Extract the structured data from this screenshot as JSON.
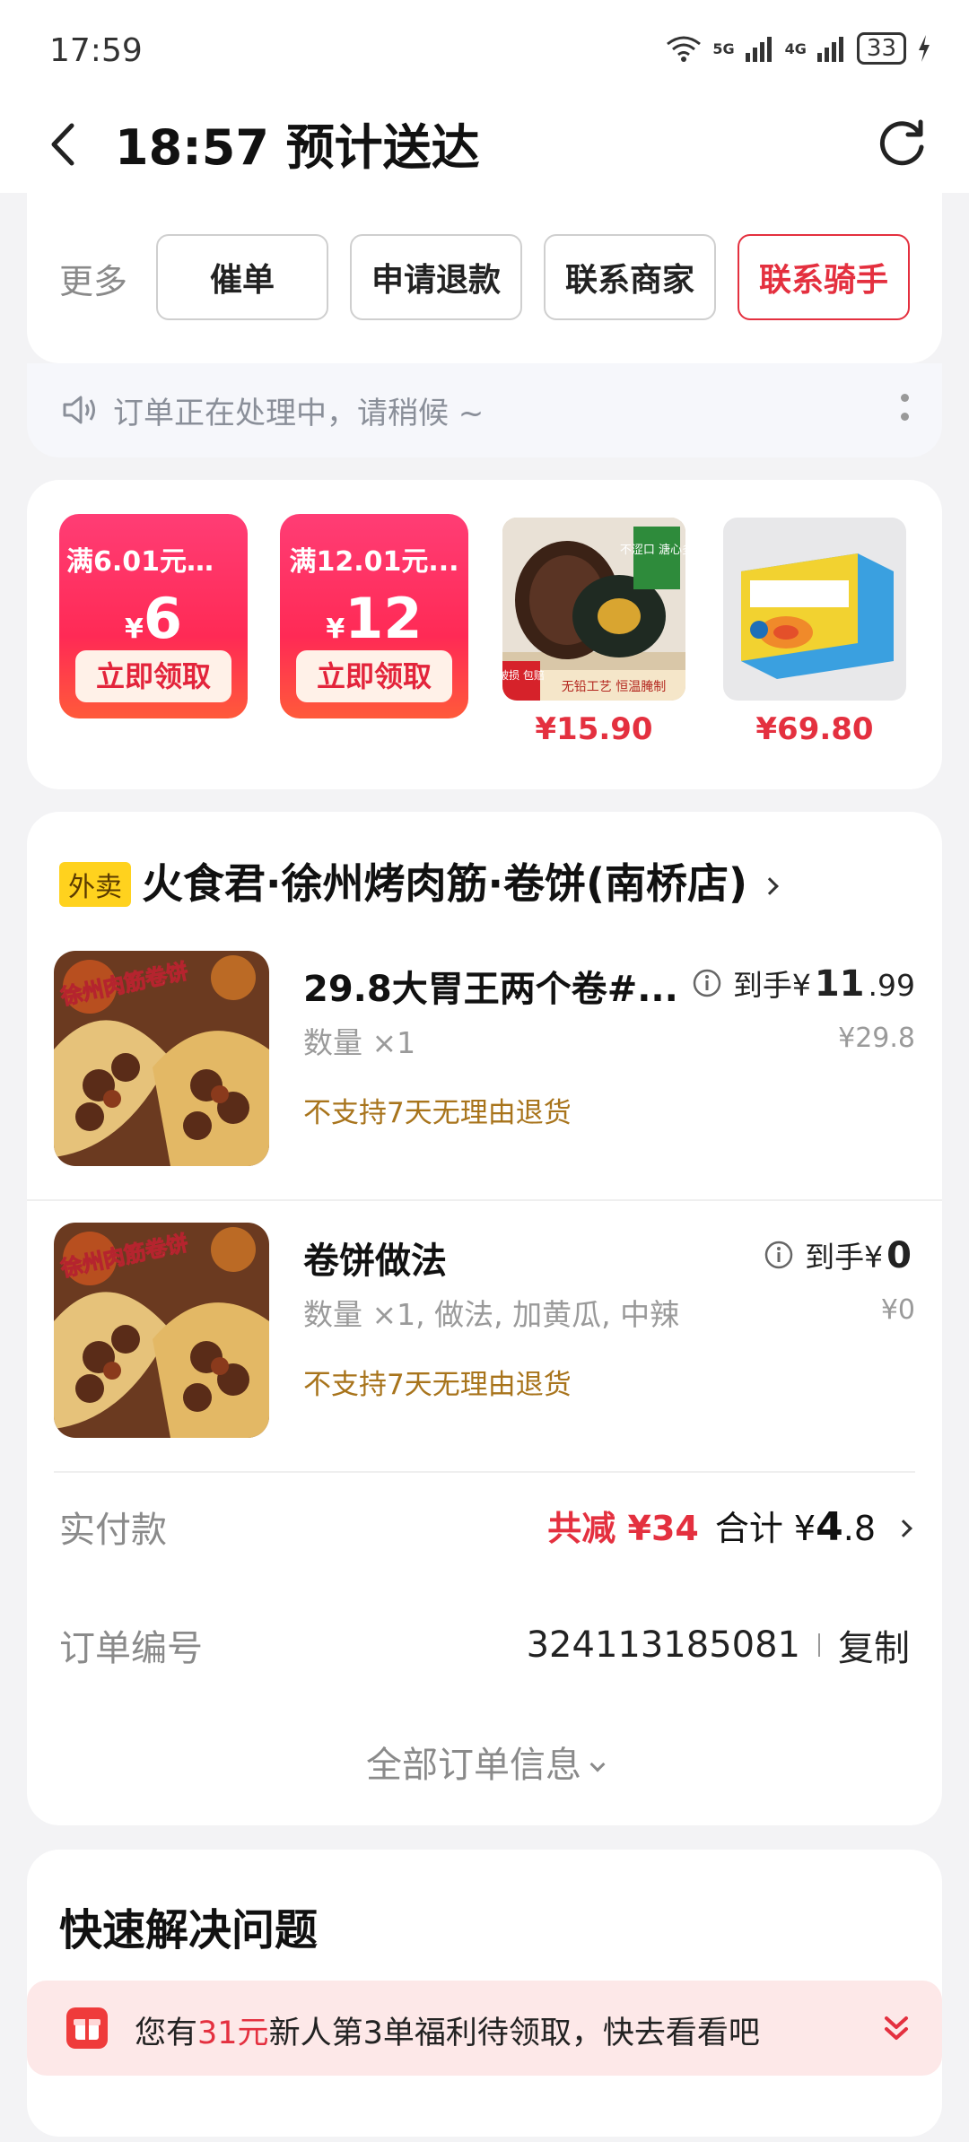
{
  "status": {
    "time": "17:59",
    "net1": "5G",
    "net2": "4G",
    "battery": "33"
  },
  "header": {
    "title": "18:57 预计送达"
  },
  "actions": {
    "more_label": "更多",
    "buttons": [
      "催单",
      "申请退款",
      "联系商家",
      "联系骑手"
    ]
  },
  "notice": {
    "text": "订单正在处理中，请稍候 ~"
  },
  "promos": {
    "coupons": [
      {
        "condition": "满6.01元可...",
        "currency": "¥",
        "amount": "6",
        "cta": "立即领取"
      },
      {
        "condition": "满12.01元...",
        "currency": "¥",
        "amount": "12",
        "cta": "立即领取"
      }
    ],
    "products": [
      {
        "price": "¥15.90",
        "label_top": "不涩口 溏心多",
        "label_bottom": "无铅工艺 恒温腌制",
        "badge": "破损 包赔"
      },
      {
        "price": "¥69.80"
      }
    ]
  },
  "order": {
    "tag": "外卖",
    "store": "火食君·徐州烤肉筋·卷饼(南桥店)",
    "items": [
      {
        "name": "29.8大胃王两个卷#...",
        "qty": "数量 ×1",
        "note": "不支持7天无理由退货",
        "price_prefix": "到手¥",
        "price_main": "11",
        "price_decimal": ".99",
        "original": "¥29.8",
        "img_text": "徐州肉筋卷饼"
      },
      {
        "name": "卷饼做法",
        "qty": "数量 ×1, 做法, 加黄瓜, 中辣",
        "note": "不支持7天无理由退货",
        "price_prefix": "到手¥",
        "price_main": "0",
        "price_decimal": "",
        "original": "¥0",
        "img_text": "徐州肉筋卷饼"
      }
    ],
    "paid_label": "实付款",
    "reduce": "共减 ¥34",
    "total_prefix": "合计 ¥",
    "total_main": "4",
    "total_decimal": ".8",
    "order_no_label": "订单编号",
    "order_no": "324113185081",
    "copy": "复制",
    "all_info": "全部订单信息"
  },
  "quick": {
    "title": "快速解决问题"
  },
  "banner": {
    "pre": "您有",
    "highlight": "31元",
    "post": "新人第3单福利待领取，快去看看吧"
  },
  "colors": {
    "accent": "#e4303f",
    "coupon": "#ff2a55",
    "note": "#a8741c",
    "tag": "#ffd21e"
  }
}
